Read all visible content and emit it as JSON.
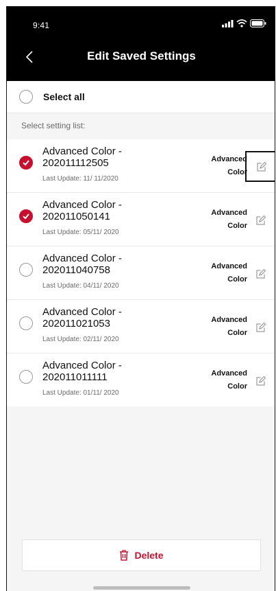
{
  "status_bar": {
    "time": "9:41"
  },
  "header": {
    "title": "Edit Saved Settings"
  },
  "select_all": {
    "label": "Select all",
    "checked": false
  },
  "section": {
    "label": "Select setting list:"
  },
  "settings": [
    {
      "name_line1": "Advanced Color -",
      "name_line2": "202011112505",
      "last_update": "Last Update:  11/ 11/2020",
      "type_line1": "Advanced",
      "type_line2": "Color",
      "checked": true
    },
    {
      "name_line1": "Advanced Color -",
      "name_line2": "202011050141",
      "last_update": "Last Update: 05/11/ 2020",
      "type_line1": "Advanced",
      "type_line2": "Color",
      "checked": true
    },
    {
      "name_line1": "Advanced Color -",
      "name_line2": "202011040758",
      "last_update": "Last Update: 04/11/ 2020",
      "type_line1": "Advanced",
      "type_line2": "Color",
      "checked": false
    },
    {
      "name_line1": "Advanced Color -",
      "name_line2": "202011021053",
      "last_update": "Last Update: 02/11/ 2020",
      "type_line1": "Advanced",
      "type_line2": "Color",
      "checked": false
    },
    {
      "name_line1": "Advanced Color -",
      "name_line2": "202011011111",
      "last_update": "Last Update: 01/11/ 2020",
      "type_line1": "Advanced",
      "type_line2": "Color",
      "checked": false
    }
  ],
  "footer": {
    "delete_label": "Delete"
  },
  "colors": {
    "accent": "#c8102e",
    "header_bg": "#000000",
    "background": "#f5f5f5"
  },
  "icons": {
    "back": "chevron-left-icon",
    "edit": "edit-icon",
    "delete": "trash-icon",
    "signal": "signal-icon",
    "wifi": "wifi-icon",
    "battery": "battery-icon"
  }
}
